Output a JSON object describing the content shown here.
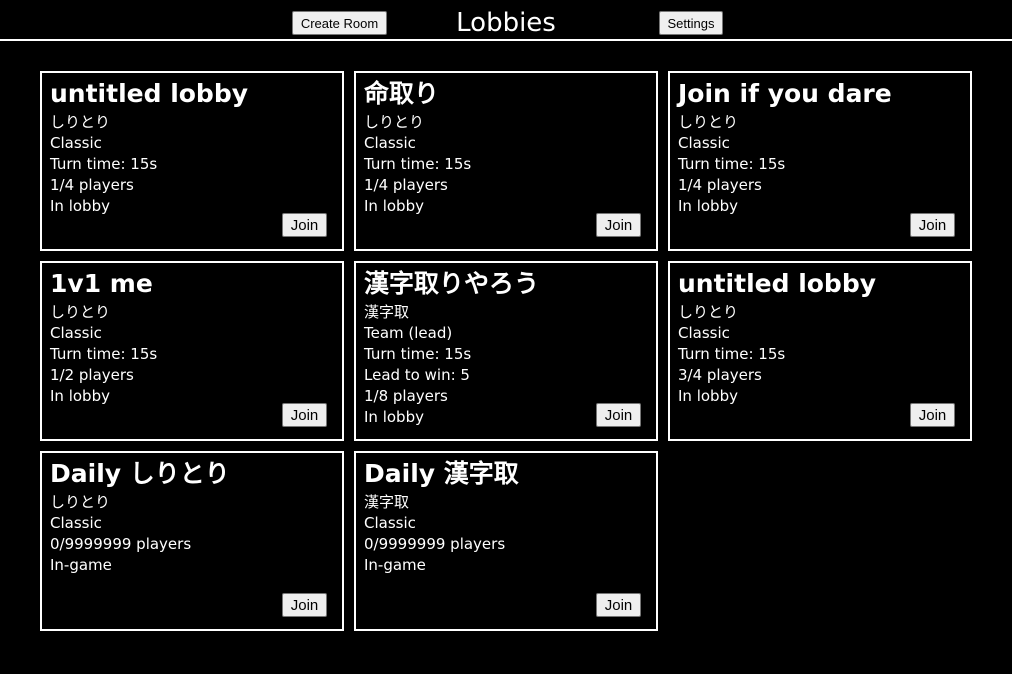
{
  "header": {
    "title": "Lobbies",
    "create_room_label": "Create Room",
    "settings_label": "Settings"
  },
  "lobbies": [
    {
      "name": "untitled lobby",
      "game": "しりとり",
      "details": [
        "Classic",
        "Turn time: 15s",
        "1/4 players",
        "In lobby"
      ],
      "join_label": "Join"
    },
    {
      "name": "命取り",
      "game": "しりとり",
      "details": [
        "Classic",
        "Turn time: 15s",
        "1/4 players",
        "In lobby"
      ],
      "join_label": "Join"
    },
    {
      "name": "Join if you dare",
      "game": "しりとり",
      "details": [
        "Classic",
        "Turn time: 15s",
        "1/4 players",
        "In lobby"
      ],
      "join_label": "Join"
    },
    {
      "name": "1v1 me",
      "game": "しりとり",
      "details": [
        "Classic",
        "Turn time: 15s",
        "1/2 players",
        "In lobby"
      ],
      "join_label": "Join"
    },
    {
      "name": "漢字取りやろう",
      "game": "漢字取",
      "details": [
        "Team (lead)",
        "Turn time: 15s",
        "Lead to win: 5",
        "1/8 players",
        "In lobby"
      ],
      "join_label": "Join"
    },
    {
      "name": "untitled lobby",
      "game": "しりとり",
      "details": [
        "Classic",
        "Turn time: 15s",
        "3/4 players",
        "In lobby"
      ],
      "join_label": "Join"
    },
    {
      "name": "Daily しりとり",
      "game": "しりとり",
      "details": [
        "Classic",
        "0/9999999 players",
        "In-game"
      ],
      "join_label": "Join"
    },
    {
      "name": "Daily 漢字取",
      "game": "漢字取",
      "details": [
        "Classic",
        "0/9999999 players",
        "In-game"
      ],
      "join_label": "Join"
    }
  ]
}
